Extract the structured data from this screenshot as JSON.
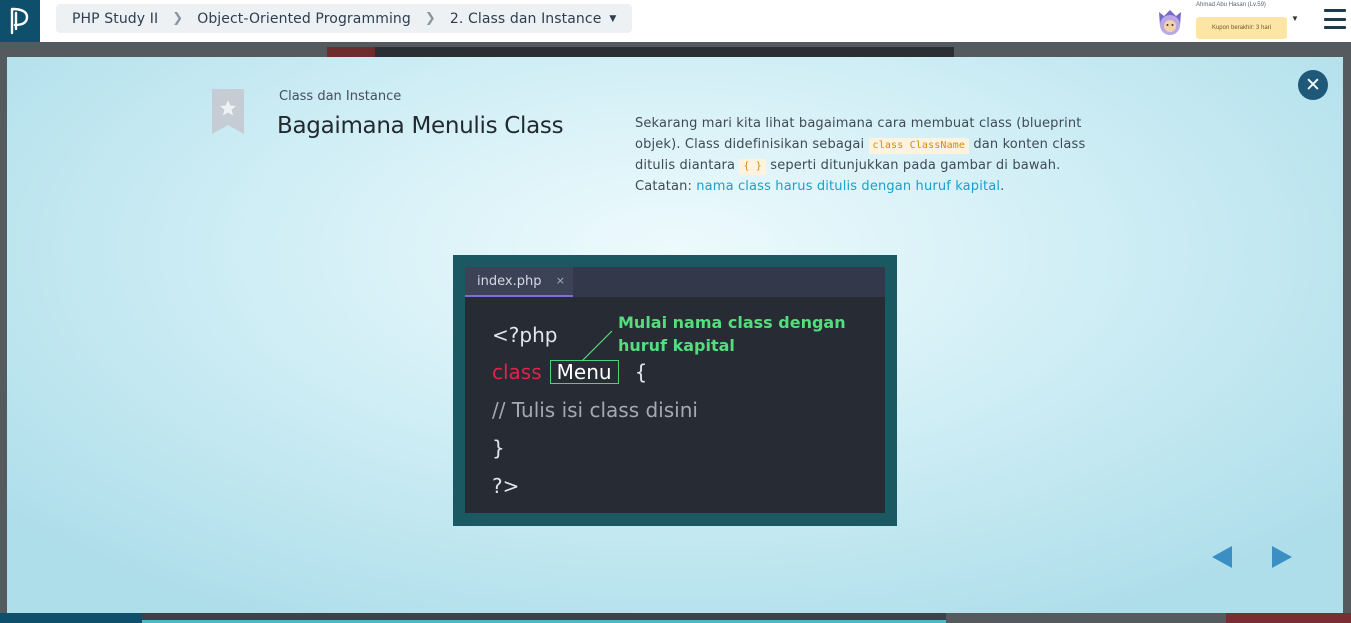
{
  "header": {
    "breadcrumb": [
      "PHP Study II",
      "Object-Oriented Programming",
      "2. Class dan Instance"
    ],
    "user_name": "Ahmad Abu Hasan (Lv.59)",
    "coupon": "Kupon berakhir: 3 hari"
  },
  "slide": {
    "subtitle": "Class dan Instance",
    "title": "Bagaimana Menulis Class",
    "desc_part1": "Sekarang mari kita lihat bagaimana cara membuat class (blueprint objek). Class didefinisikan sebagai ",
    "desc_code1": "class ClassName",
    "desc_part2": " dan konten class ditulis diantara ",
    "desc_code2": "{ }",
    "desc_part3": " seperti ditunjukkan pada gambar di bawah.",
    "note_label": "Catatan: ",
    "note_link": "nama class harus ditulis dengan huruf kapital",
    "note_end": "."
  },
  "editor": {
    "tab": "index.php",
    "tab_close": "×",
    "line1": "<?php",
    "line2_kw": "class",
    "line2_name": "Menu",
    "line2_brace": "{",
    "line3": "// Tulis isi class disini",
    "line4": "}",
    "line5": "?>",
    "annotation_1": "Mulai nama class dengan",
    "annotation_2": "huruf kapital"
  },
  "colors": {
    "accent": "#1f5878",
    "link": "#1aa0c9",
    "keyword": "#e0234d",
    "annotation": "#54dd7e"
  },
  "icons": {
    "logo": "progate-logo",
    "close": "close-icon",
    "bookmark": "bookmark-star-icon",
    "prev": "prev-arrow-icon",
    "next": "next-arrow-icon",
    "menu": "hamburger-menu-icon"
  }
}
